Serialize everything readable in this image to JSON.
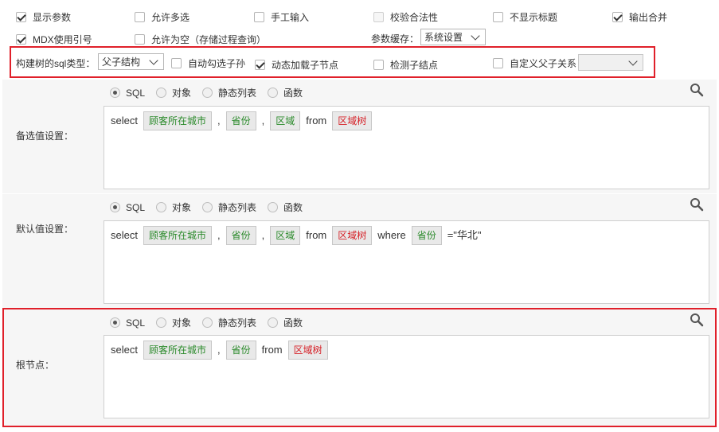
{
  "row1": [
    {
      "label": "显示参数",
      "checked": true,
      "disabled": false
    },
    {
      "label": "允许多选",
      "checked": false,
      "disabled": false
    },
    {
      "label": "手工输入",
      "checked": false,
      "disabled": false
    },
    {
      "label": "校验合法性",
      "checked": false,
      "disabled": true
    },
    {
      "label": "不显示标题",
      "checked": false,
      "disabled": false
    },
    {
      "label": "输出合并",
      "checked": true,
      "disabled": false
    }
  ],
  "row2": {
    "mdx": {
      "label": "MDX使用引号",
      "checked": true
    },
    "allow_empty": {
      "label": "允许为空（存储过程查询）",
      "checked": false
    },
    "cache_label": "参数缓存：",
    "cache_value": "系统设置"
  },
  "tree": {
    "type_label": "构建树的sql类型：",
    "type_value": "父子结构",
    "auto_check": {
      "label": "自动勾选子孙",
      "checked": false
    },
    "dynamic_load": {
      "label": "动态加载子节点",
      "checked": true
    },
    "detect_leaf": {
      "label": "检测子结点",
      "checked": false
    },
    "custom_relation": {
      "label": "自定义父子关系",
      "checked": false
    },
    "custom_relation_value": ""
  },
  "radio_options": [
    "SQL",
    "对象",
    "静态列表",
    "函数"
  ],
  "sections": [
    {
      "label": "备选值设置：",
      "selected": "SQL",
      "tokens": [
        {
          "t": "kw",
          "v": "select"
        },
        {
          "t": "green",
          "v": "顾客所在城市"
        },
        {
          "t": "kw",
          "v": ","
        },
        {
          "t": "green",
          "v": "省份"
        },
        {
          "t": "kw",
          "v": ","
        },
        {
          "t": "green",
          "v": "区域"
        },
        {
          "t": "kw",
          "v": "from"
        },
        {
          "t": "red",
          "v": "区域树"
        }
      ]
    },
    {
      "label": "默认值设置：",
      "selected": "SQL",
      "tokens": [
        {
          "t": "kw",
          "v": "select"
        },
        {
          "t": "green",
          "v": "顾客所在城市"
        },
        {
          "t": "kw",
          "v": ","
        },
        {
          "t": "green",
          "v": "省份"
        },
        {
          "t": "kw",
          "v": ","
        },
        {
          "t": "green",
          "v": "区域"
        },
        {
          "t": "kw",
          "v": "from"
        },
        {
          "t": "red",
          "v": "区域树"
        },
        {
          "t": "kw",
          "v": "where"
        },
        {
          "t": "green",
          "v": "省份"
        },
        {
          "t": "kw",
          "v": "=\"华北\""
        }
      ]
    },
    {
      "label": "根节点：",
      "selected": "SQL",
      "tokens": [
        {
          "t": "kw",
          "v": "select"
        },
        {
          "t": "green",
          "v": "顾客所在城市"
        },
        {
          "t": "kw",
          "v": ","
        },
        {
          "t": "green",
          "v": "省份"
        },
        {
          "t": "kw",
          "v": "from"
        },
        {
          "t": "red",
          "v": "区域树"
        }
      ]
    }
  ]
}
